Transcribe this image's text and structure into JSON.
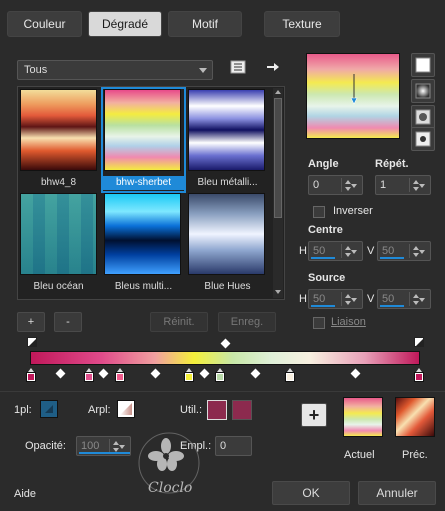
{
  "tabs": [
    {
      "label": "Couleur",
      "active": false
    },
    {
      "label": "Dégradé",
      "active": true
    },
    {
      "label": "Motif",
      "active": false
    },
    {
      "label": "Texture",
      "active": false
    }
  ],
  "category_select": {
    "value": "Tous"
  },
  "thumbnails": [
    {
      "label": "bhw4_8",
      "selected": false
    },
    {
      "label": "bhw-sherbet",
      "selected": true
    },
    {
      "label": "Bleu métalli...",
      "selected": false
    },
    {
      "label": "Bleu océan",
      "selected": false
    },
    {
      "label": "Bleus multi...",
      "selected": false
    },
    {
      "label": "Blue Hues",
      "selected": false
    }
  ],
  "buttons": {
    "add": "+",
    "remove": "-",
    "reset": "Réinit.",
    "save": "Enreg.",
    "ok": "OK",
    "cancel": "Annuler",
    "help": "Aide",
    "add_swatch": "+"
  },
  "angle": {
    "label": "Angle",
    "value": "0"
  },
  "repeat": {
    "label": "Répét.",
    "value": "1"
  },
  "invert": {
    "label": "Inverser",
    "checked": false
  },
  "center": {
    "label": "Centre",
    "h_label": "H",
    "h": "50",
    "v_label": "V",
    "v": "50"
  },
  "source": {
    "label": "Source",
    "h_label": "H",
    "h": "50",
    "v_label": "V",
    "v": "50"
  },
  "link": {
    "label": "Liaison",
    "checked": false
  },
  "bottom": {
    "opacity_stop_label": "1pl:",
    "arpl_label": "Arpl:",
    "util_label": "Util.:",
    "opacity_label": "Opacité:",
    "opacity_value": "100",
    "location_label": "Empl.:",
    "location_value": "0",
    "current_label": "Actuel",
    "previous_label": "Préc."
  },
  "watermark": "Cloclo",
  "colors": {
    "accent": "#1f8ad8",
    "dialog_bg": "#2b2b2b",
    "selected_user_color": "#8c2a4e"
  },
  "gradient_stops": [
    {
      "color": "#c0185a"
    },
    {
      "color": "#e0508c"
    },
    {
      "color": "#f05c8c"
    },
    {
      "color": "#f4ef3a"
    },
    {
      "color": "#b8d8a8"
    },
    {
      "color": "#f8f0e0"
    },
    {
      "color": "#c0185a"
    }
  ]
}
